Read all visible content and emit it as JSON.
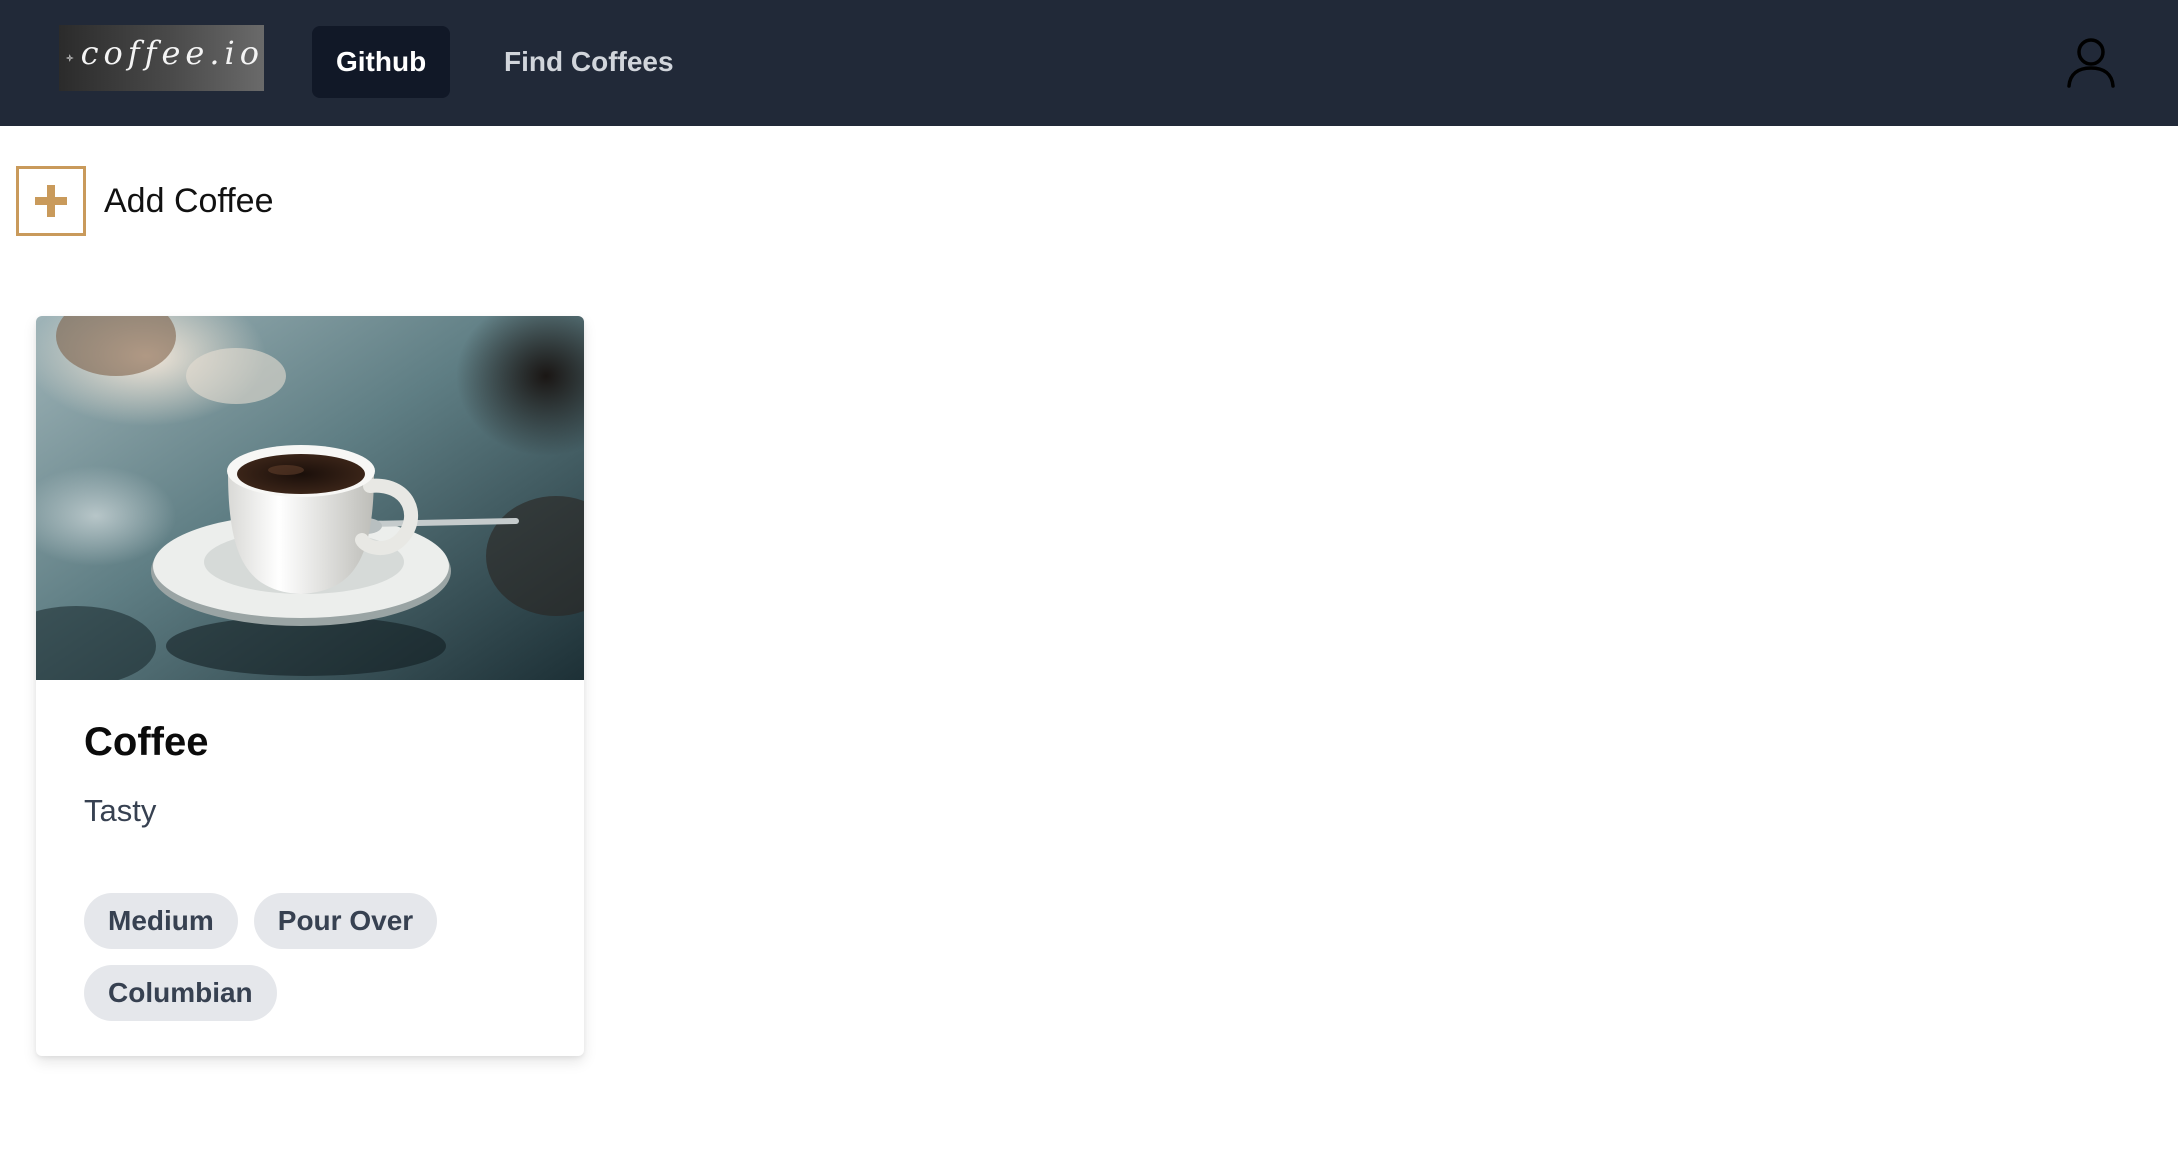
{
  "brand": {
    "logo_text": "coffee.io",
    "logo_icon": "diamond-sparkle-icon"
  },
  "nav": {
    "items": [
      {
        "label": "Github",
        "active": true
      },
      {
        "label": "Find Coffees",
        "active": false
      }
    ],
    "user_icon": "user-icon"
  },
  "toolbar": {
    "add_label": "Add Coffee",
    "add_icon": "plus-icon"
  },
  "coffees": [
    {
      "name": "Coffee",
      "description": "Tasty",
      "image": "coffee-cup-photo",
      "tags": [
        "Medium",
        "Pour Over",
        "Columbian"
      ]
    }
  ],
  "colors": {
    "nav_bg": "#212938",
    "nav_active_bg": "#111827",
    "accent": "#c99a5b",
    "tag_bg": "#e5e7eb"
  }
}
